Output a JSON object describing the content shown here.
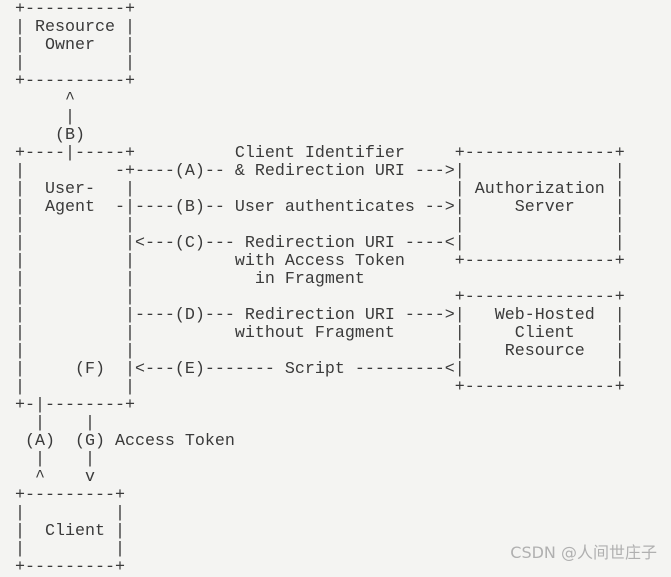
{
  "diagram": {
    "lines": [
      "+----------+",
      "| Resource |",
      "|  Owner   |",
      "|          |",
      "+----------+",
      "     ^",
      "     |",
      "    (B)",
      "+----|-----+          Client Identifier     +---------------+",
      "|         -+----(A)-- & Redirection URI --->|               |",
      "|  User-   |                                | Authorization |",
      "|  Agent  -|----(B)-- User authenticates -->|     Server    |",
      "|          |                                |               |",
      "|          |<---(C)--- Redirection URI ----<|               |",
      "|          |          with Access Token     +---------------+",
      "|          |            in Fragment",
      "|          |                                +---------------+",
      "|          |----(D)--- Redirection URI ---->|   Web-Hosted  |",
      "|          |          without Fragment      |     Client    |",
      "|          |                                |    Resource   |",
      "|     (F)  |<---(E)------- Script ---------<|               |",
      "|          |                                +---------------+",
      "+-|--------+",
      "  |    |",
      " (A)  (G) Access Token",
      "  |    |",
      "  ^    v",
      "+---------+",
      "|         |",
      "|  Client |",
      "|         |",
      "+---------+"
    ]
  },
  "watermark": "CSDN @人间世庄子"
}
